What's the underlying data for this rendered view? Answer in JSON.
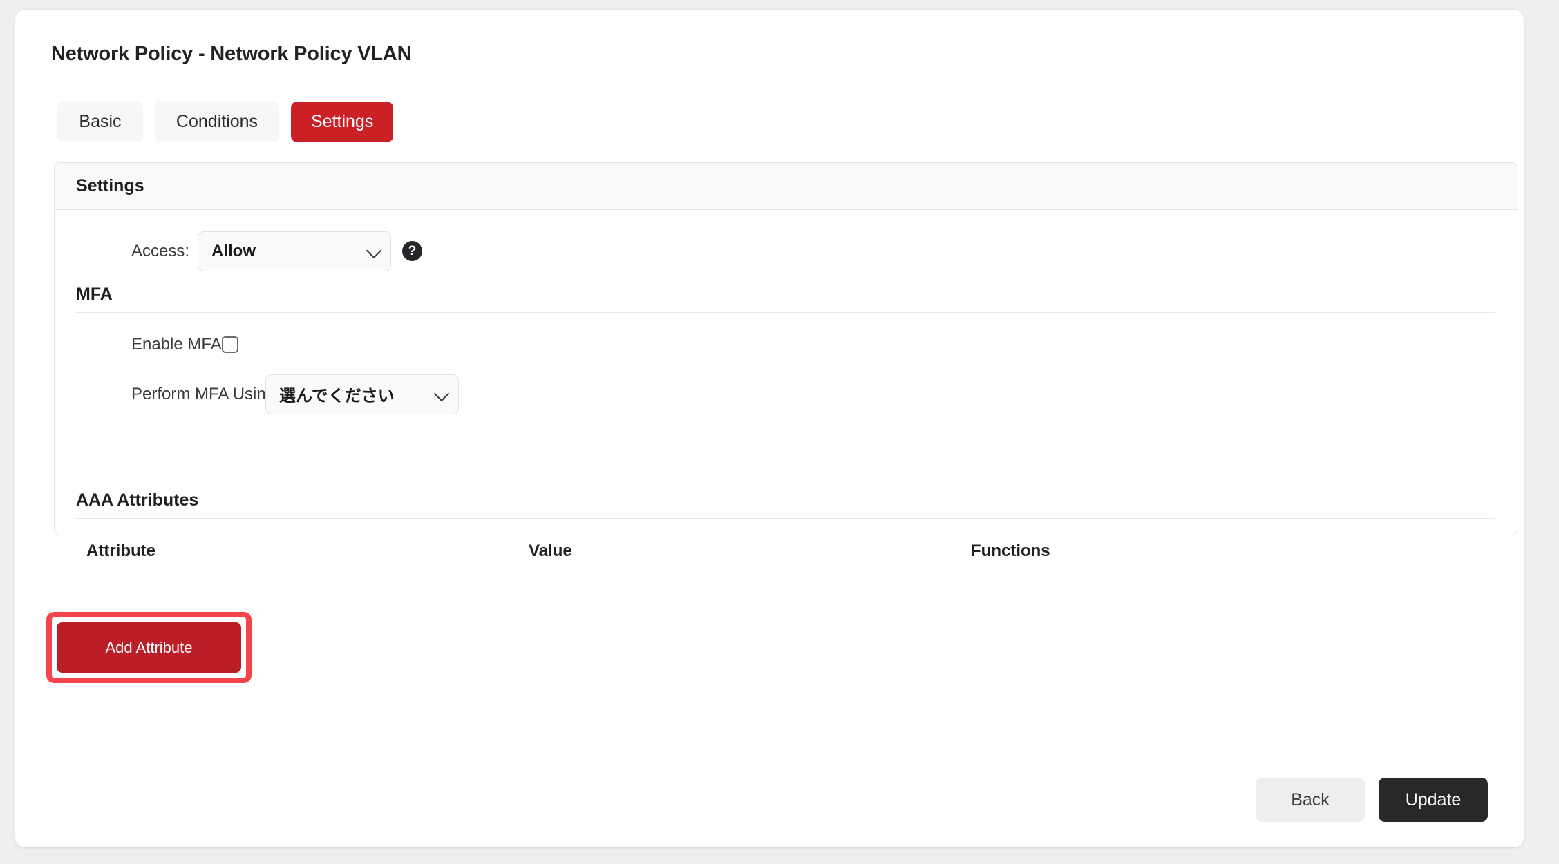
{
  "page": {
    "title": "Network Policy - Network Policy VLAN",
    "background_color": "#efefef",
    "card_color": "#ffffff"
  },
  "tabs": [
    {
      "label": "Basic",
      "active": false
    },
    {
      "label": "Conditions",
      "active": false
    },
    {
      "label": "Settings",
      "active": true
    }
  ],
  "settings_panel": {
    "header_title": "Settings",
    "access": {
      "label": "Access:",
      "value": "Allow",
      "help_icon": "question-mark-icon"
    },
    "mfa": {
      "section_title": "MFA",
      "enable_label": "Enable MFA",
      "enable_checked": false,
      "perform_label": "Perform MFA Using:",
      "perform_value": "選んでください"
    },
    "aaa": {
      "section_title": "AAA Attributes",
      "columns": [
        "Attribute",
        "Value",
        "Functions"
      ],
      "rows": [],
      "add_button_label": "Add Attribute"
    }
  },
  "footer": {
    "back_label": "Back",
    "update_label": "Update"
  },
  "colors": {
    "accent_red": "#cc2027",
    "button_red": "#bb1e27",
    "highlight_red": "#f4454c",
    "dark_button": "#282828",
    "light_button": "#eeeeee"
  }
}
